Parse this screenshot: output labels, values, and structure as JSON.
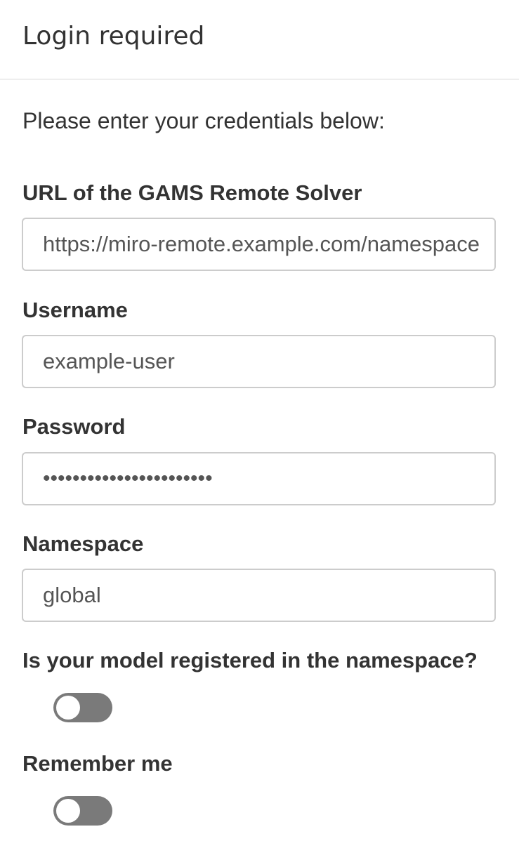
{
  "dialog": {
    "title": "Login required",
    "intro": "Please enter your credentials below:"
  },
  "fields": {
    "url": {
      "label": "URL of the GAMS Remote Solver",
      "value": "https://miro-remote.example.com/namespace"
    },
    "username": {
      "label": "Username",
      "value": "example-user"
    },
    "password": {
      "label": "Password",
      "value": "•••••••••••••••••••••••"
    },
    "namespace": {
      "label": "Namespace",
      "value": "global"
    }
  },
  "toggles": {
    "registered": {
      "label": "Is your model registered in the namespace?",
      "state": "off"
    },
    "remember": {
      "label": "Remember me",
      "state": "off"
    }
  },
  "colors": {
    "toggle_off": "#7a7a7a",
    "border": "#cccccc",
    "text": "#333333"
  }
}
